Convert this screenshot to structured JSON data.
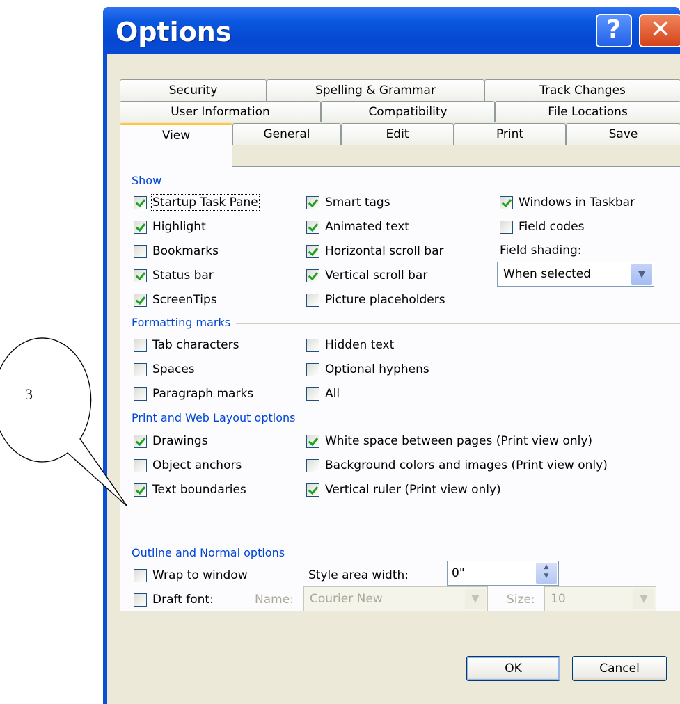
{
  "dialog": {
    "title": "Options",
    "help_glyph": "?",
    "close_glyph": "✕",
    "tabs_row1": [
      "Security",
      "Spelling & Grammar",
      "Track Changes"
    ],
    "tabs_row2": [
      "User Information",
      "Compatibility",
      "File Locations"
    ],
    "tabs_row3": [
      "View",
      "General",
      "Edit",
      "Print",
      "Save"
    ],
    "active_tab": "View",
    "show": {
      "header": "Show",
      "col1": [
        {
          "label": "Startup Task Pane",
          "checked": true
        },
        {
          "label": "Highlight",
          "checked": true
        },
        {
          "label": "Bookmarks",
          "checked": false
        },
        {
          "label": "Status bar",
          "checked": true
        },
        {
          "label": "ScreenTips",
          "checked": true
        }
      ],
      "col2": [
        {
          "label": "Smart tags",
          "checked": true
        },
        {
          "label": "Animated text",
          "checked": true
        },
        {
          "label": "Horizontal scroll bar",
          "checked": true
        },
        {
          "label": "Vertical scroll bar",
          "checked": true
        },
        {
          "label": "Picture placeholders",
          "checked": false
        }
      ],
      "col3": [
        {
          "label": "Windows in Taskbar",
          "checked": true
        },
        {
          "label": "Field codes",
          "checked": false
        }
      ],
      "field_shading_label": "Field shading:",
      "field_shading_value": "When selected"
    },
    "formatting": {
      "header": "Formatting marks",
      "col1": [
        {
          "label": "Tab characters",
          "checked": false
        },
        {
          "label": "Spaces",
          "checked": false
        },
        {
          "label": "Paragraph marks",
          "checked": false
        }
      ],
      "col2": [
        {
          "label": "Hidden text",
          "checked": false
        },
        {
          "label": "Optional hyphens",
          "checked": false
        },
        {
          "label": "All",
          "checked": false
        }
      ]
    },
    "print_web": {
      "header": "Print and Web Layout options",
      "col1": [
        {
          "label": "Drawings",
          "checked": true
        },
        {
          "label": "Object anchors",
          "checked": false
        },
        {
          "label": "Text boundaries",
          "checked": true
        }
      ],
      "col2": [
        {
          "label": "White space between pages (Print view only)",
          "checked": true
        },
        {
          "label": "Background colors and images (Print view only)",
          "checked": false
        },
        {
          "label": "Vertical ruler (Print view only)",
          "checked": true
        }
      ]
    },
    "outline": {
      "header": "Outline and Normal options",
      "wrap_label": "Wrap to window",
      "wrap_checked": false,
      "draft_label": "Draft font:",
      "draft_checked": false,
      "style_area_label": "Style area width:",
      "style_area_value": "0\"",
      "name_label": "Name:",
      "name_value": "Courier New",
      "size_label": "Size:",
      "size_value": "10"
    },
    "ok_label": "OK",
    "cancel_label": "Cancel"
  },
  "callout": {
    "number": "3"
  }
}
